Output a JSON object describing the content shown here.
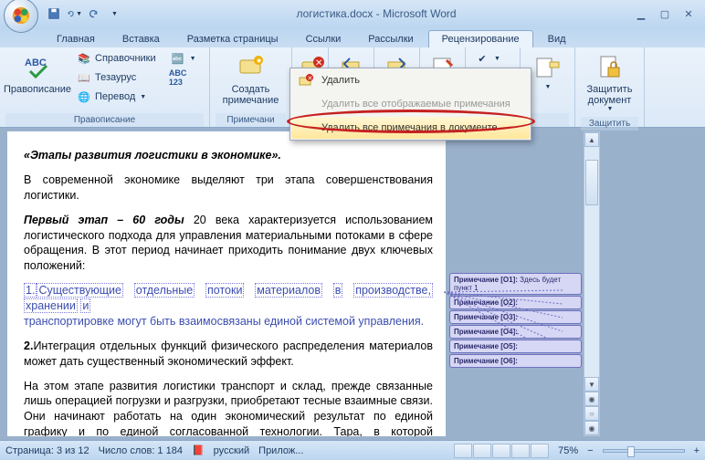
{
  "titlebar": {
    "title": "логистика.docx - Microsoft Word"
  },
  "tabs": {
    "items": [
      "Главная",
      "Вставка",
      "Разметка страницы",
      "Ссылки",
      "Рассылки",
      "Рецензирование",
      "Вид"
    ],
    "active_index": 5
  },
  "ribbon": {
    "proofing": {
      "spelling": "Правописание",
      "research": "Справочники",
      "thesaurus": "Тезаурус",
      "translate": "Перевод",
      "group_label": "Правописание"
    },
    "comments": {
      "new_comment": "Создать примечание",
      "group_label": "Примечани"
    },
    "protect": {
      "protect": "Защитить документ",
      "group_label": "Защитить"
    }
  },
  "dropdown": {
    "delete": "Удалить",
    "delete_shown": "Удалить все отображаемые примечания",
    "delete_all": "Удалить все примечания в документе"
  },
  "document": {
    "line1": "«Этапы развития логистики в экономике».",
    "para1": "В современной экономике выделяют три этапа совершенствования логистики.",
    "para2_lead": "Первый этап – 60 годы",
    "para2_rest": " 20 века характеризуется использованием логистического подхода для управления материальными потоками в сфере обращения. В этот период начинает приходить понимание двух ключевых положений:",
    "bullet1_num": "1.",
    "bullet1_words": [
      "Существующие",
      "отдельные",
      "потоки",
      "материалов",
      "в",
      "производстве,",
      "хранении",
      "и"
    ],
    "bullet1_line2": "транспортировке могут быть взаимосвязаны единой системой управления.",
    "bullet2": "2.Интеграция отдельных функций физического распределения материалов может дать существенный экономический эффект.",
    "para3": "На этом этапе развития логистики транспорт и склад, прежде связанные лишь операцией погрузки и разгрузки, приобретают тесные взаимные связи. Они начинают работать на один экономический результат по единой графику и по единой согласованной технологии. Тара, в которой отгружается груз,"
  },
  "comments": [
    {
      "label": "Примечание [O1]:",
      "text": "Здесь будет пункт 1"
    },
    {
      "label": "Примечание [O2]:",
      "text": ""
    },
    {
      "label": "Примечание [O3]:",
      "text": ""
    },
    {
      "label": "Примечание [O4]:",
      "text": ""
    },
    {
      "label": "Примечание [O5]:",
      "text": ""
    },
    {
      "label": "Примечание [O6]:",
      "text": ""
    }
  ],
  "statusbar": {
    "page": "Страница: 3 из 12",
    "words": "Число слов: 1 184",
    "lang": "русский",
    "attach": "Прилож...",
    "zoom": "75%"
  }
}
